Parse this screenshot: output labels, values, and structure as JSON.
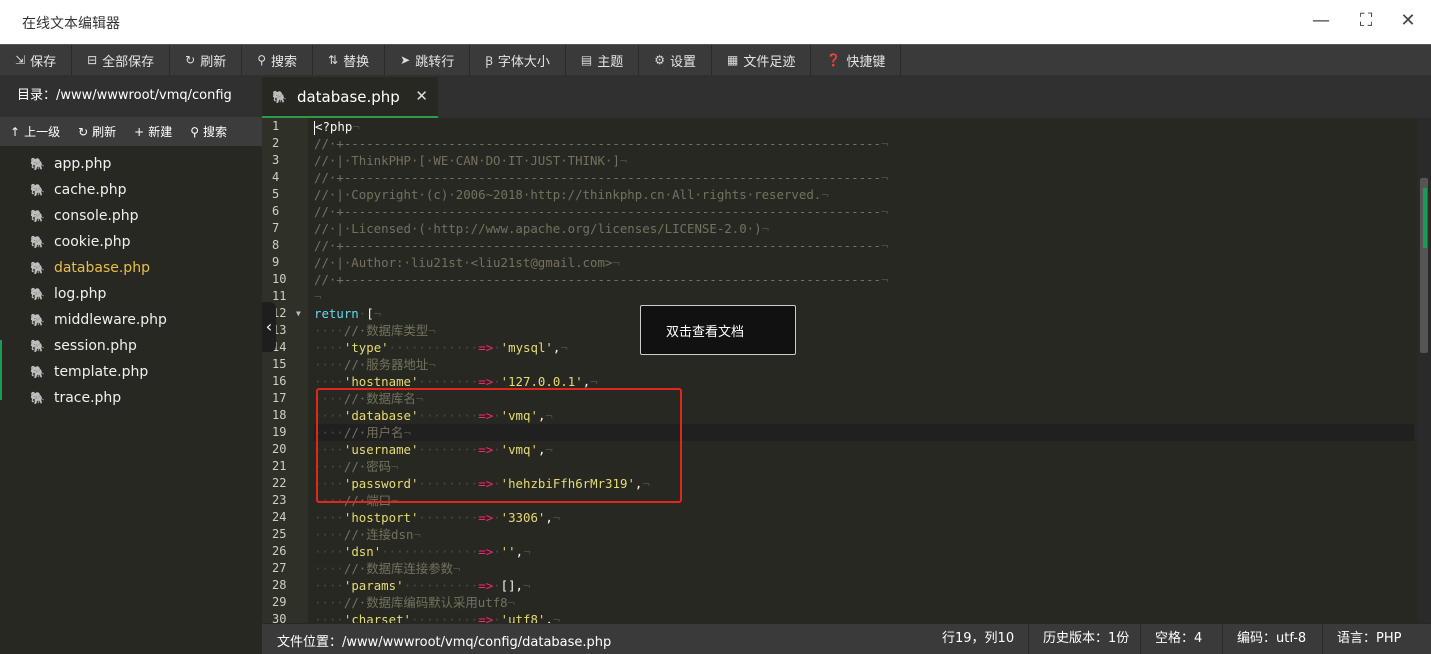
{
  "window": {
    "title": "在线文本编辑器",
    "minimize": "—",
    "maximize": "⛶",
    "close": "✕"
  },
  "toolbar": {
    "items": [
      {
        "icon": "save-icon",
        "glyph": "⇲",
        "label": "保存"
      },
      {
        "icon": "save-all-icon",
        "glyph": "⊟",
        "label": "全部保存"
      },
      {
        "icon": "refresh-icon",
        "glyph": "↻",
        "label": "刷新"
      },
      {
        "icon": "search-icon",
        "glyph": "⚲",
        "label": "搜索"
      },
      {
        "icon": "replace-icon",
        "glyph": "⇅",
        "label": "替换"
      },
      {
        "icon": "goto-icon",
        "glyph": "➤",
        "label": "跳转行"
      },
      {
        "icon": "font-size-icon",
        "glyph": "Ꞵ",
        "label": "字体大小"
      },
      {
        "icon": "theme-icon",
        "glyph": "▤",
        "label": "主题"
      },
      {
        "icon": "settings-icon",
        "glyph": "⚙",
        "label": "设置"
      },
      {
        "icon": "history-icon",
        "glyph": "▦",
        "label": "文件足迹"
      },
      {
        "icon": "help-icon",
        "glyph": "❓",
        "label": "快捷键"
      }
    ]
  },
  "sidebar": {
    "path": "目录：/www/wwwroot/vmq/config",
    "actions": [
      {
        "glyph": "↑",
        "label": "上一级"
      },
      {
        "glyph": "↻",
        "label": "刷新"
      },
      {
        "glyph": "+",
        "label": "新建"
      },
      {
        "glyph": "⚲",
        "label": "搜索"
      }
    ],
    "files": [
      "app.php",
      "cache.php",
      "console.php",
      "cookie.php",
      "database.php",
      "log.php",
      "middleware.php",
      "session.php",
      "template.php",
      "trace.php"
    ],
    "active_file": "database.php"
  },
  "tab": {
    "label": "database.php",
    "close": "✕"
  },
  "editor": {
    "line_numbers": [
      "1",
      "2",
      "3",
      "4",
      "5",
      "6",
      "7",
      "8",
      "9",
      "10",
      "11",
      "12",
      "13",
      "14",
      "15",
      "16",
      "17",
      "18",
      "19",
      "20",
      "21",
      "22",
      "23",
      "24",
      "25",
      "26",
      "27",
      "28",
      "29",
      "30"
    ],
    "current_line": 19,
    "tooltip": "双击查看文档"
  },
  "status": {
    "file_location": "文件位置：/www/wwwroot/vmq/config/database.php",
    "cursor": "行19，列10",
    "history": "历史版本：1份",
    "indent": "空格：4",
    "encoding": "编码：utf-8",
    "language": "语言：PHP"
  },
  "colors": {
    "editor_bg": "#272822",
    "comment": "#75715e",
    "keyword": "#66d9ef",
    "string": "#e6db74",
    "operator": "#f92672",
    "active_file": "#e8bf4a",
    "highlight_box": "#e0261d"
  }
}
